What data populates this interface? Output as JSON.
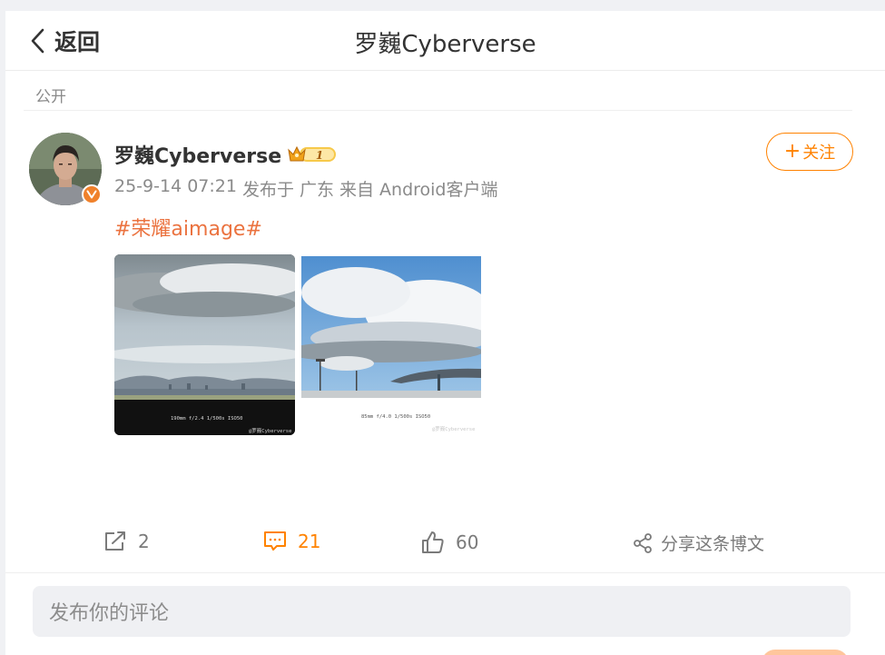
{
  "header": {
    "back_label": "返回",
    "title": "罗巍Cyberverse"
  },
  "visibility": "公开",
  "post": {
    "author": "罗巍Cyberverse",
    "vip_level": "1",
    "date": "25-9-14 07:21",
    "published_in": "发布于 广东",
    "source": "来自 Android客户端",
    "follow_label": "关注",
    "hashtag": "#荣耀aimage#",
    "images": [
      {
        "caption": "190mm  f/2.4  1/500s  ISO50",
        "watermark": "@罗巍Cyberverse"
      },
      {
        "caption": "85mm  f/4.0  1/500s  ISO50",
        "watermark": "@罗巍Cyberverse"
      }
    ]
  },
  "actions": {
    "reposts": "2",
    "comments": "21",
    "likes": "60",
    "share_label": "分享这条博文"
  },
  "comment_input": {
    "placeholder": "发布你的评论"
  },
  "colors": {
    "accent": "#ff8200",
    "hashtag": "#eb7340",
    "verified_badge": "#f0812b"
  },
  "icons": [
    "chevron-left-icon",
    "verified-icon",
    "vip-crown-icon",
    "plus-icon",
    "repost-icon",
    "comment-icon",
    "like-icon",
    "share-icon"
  ]
}
